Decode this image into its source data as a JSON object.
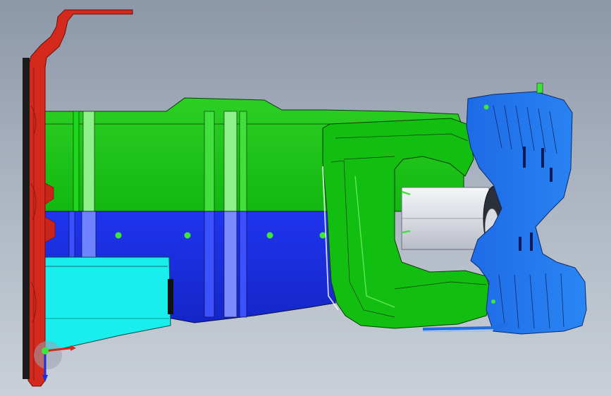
{
  "viewport": {
    "background_top": "#8c97a8",
    "background_bottom": "#c9d0d8"
  },
  "colors": {
    "red_bracket": "#d42a1e",
    "red_dark": "#8f1710",
    "green_part": "#17c314",
    "green_light": "#6fe86a",
    "blue_part": "#1a2fe0",
    "blue_light": "#4a60ff",
    "cyan_part": "#18f0ee",
    "azure_part": "#1f6fe8",
    "silver_part": "#e2e4ea",
    "grip_dots": "#3ee63a",
    "edge_lines": "#0c3a0c"
  },
  "triad": {
    "x_axis_color": "#d42a1e",
    "y_axis_color": "#1a2fe0",
    "origin_color": "#3ee63a"
  }
}
